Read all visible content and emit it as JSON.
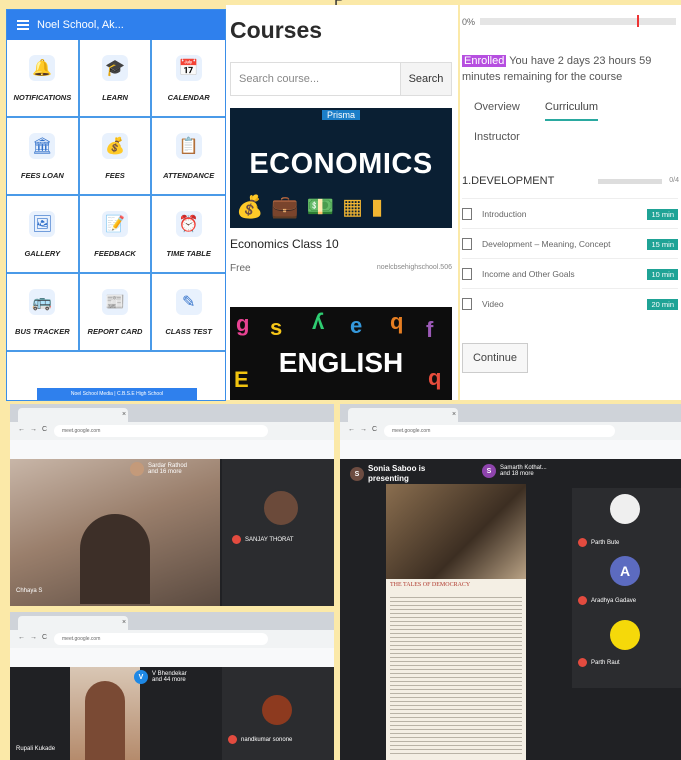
{
  "top_text": "P",
  "school_app": {
    "title": "Noel School, Ak...",
    "items": [
      {
        "label": "NOTIFICATIONS",
        "icon": "bell-icon",
        "glyph": "🔔"
      },
      {
        "label": "LEARN",
        "icon": "graduation-cap-icon",
        "glyph": "🎓"
      },
      {
        "label": "CALENDAR",
        "icon": "calendar-icon",
        "glyph": "📅"
      },
      {
        "label": "FEES LOAN",
        "icon": "bank-icon",
        "glyph": "🏛"
      },
      {
        "label": "FEES",
        "icon": "money-hand-icon",
        "glyph": "💰"
      },
      {
        "label": "ATTENDANCE",
        "icon": "clipboard-icon",
        "glyph": "📋"
      },
      {
        "label": "GALLERY",
        "icon": "image-icon",
        "glyph": "🖼"
      },
      {
        "label": "FEEDBACK",
        "icon": "notepad-icon",
        "glyph": "📝"
      },
      {
        "label": "TIME TABLE",
        "icon": "alarm-clock-icon",
        "glyph": "⏰"
      },
      {
        "label": "BUS TRACKER",
        "icon": "bus-icon",
        "glyph": "🚌"
      },
      {
        "label": "REPORT CARD",
        "icon": "report-card-icon",
        "glyph": "📰"
      },
      {
        "label": "CLASS TEST",
        "icon": "edit-icon",
        "glyph": "✎"
      }
    ],
    "footer": "Noel School Media | C.B.S.E High School"
  },
  "courses": {
    "heading": "Courses",
    "search_placeholder": "Search course...",
    "search_button": "Search",
    "course1": {
      "brand": "Prisma",
      "thumb_title": "ECONOMICS",
      "title": "Economics Class 10",
      "price": "Free",
      "provider": "noelcbsehighschool.506"
    },
    "course2": {
      "thumb_title": "ENGLISH"
    }
  },
  "curriculum": {
    "progress": "0%",
    "progress_fraction": 0.0,
    "enrolled_badge": "Enrolled",
    "enrolled_text": "You have 2 days 23 hours 59 minutes remaining for the course",
    "tabs": [
      "Overview",
      "Curriculum",
      "Instructor"
    ],
    "active_tab": "Curriculum",
    "section_title": "1.DEVELOPMENT",
    "section_count": "0/4",
    "lessons": [
      {
        "title": "Introduction",
        "duration": "15 min"
      },
      {
        "title": "Development – Meaning, Concept",
        "duration": "15 min"
      },
      {
        "title": "Income and Other Goals",
        "duration": "10 min"
      },
      {
        "title": "Video",
        "duration": "20 min"
      }
    ],
    "continue_button": "Continue"
  },
  "meet1": {
    "url": "meet.google.com",
    "top_chip": "Sardar Rathod\nand 16 more",
    "tile_name": "SANJAY THORAT",
    "self_name": "Chhaya S",
    "icon_count": "45"
  },
  "meet2": {
    "url": "meet.google.com",
    "presenter": "Sonia Saboo is presenting",
    "top_chip": "Samarth Kothat...\nand 18 more",
    "article_heading": "THE TALES OF DEMOCRACY",
    "participants": [
      {
        "name": "Parth Bute",
        "initial": ""
      },
      {
        "name": "Aradhya Gadave",
        "initial": "A"
      },
      {
        "name": "Parth Raut",
        "initial": ""
      }
    ]
  },
  "meet3": {
    "url": "meet.google.com",
    "top_chip": "V Bhendekar\nand 44 more",
    "top_initial": "V",
    "tile_name": "nandkumar sonone",
    "self_name": "Rupali Kukade"
  },
  "colors": {
    "bg": "#fbe9a8",
    "app_blue": "#2f80ed",
    "teal": "#1fa396",
    "enrolled_purple": "#b64fe0",
    "meet_dark": "#202124"
  }
}
